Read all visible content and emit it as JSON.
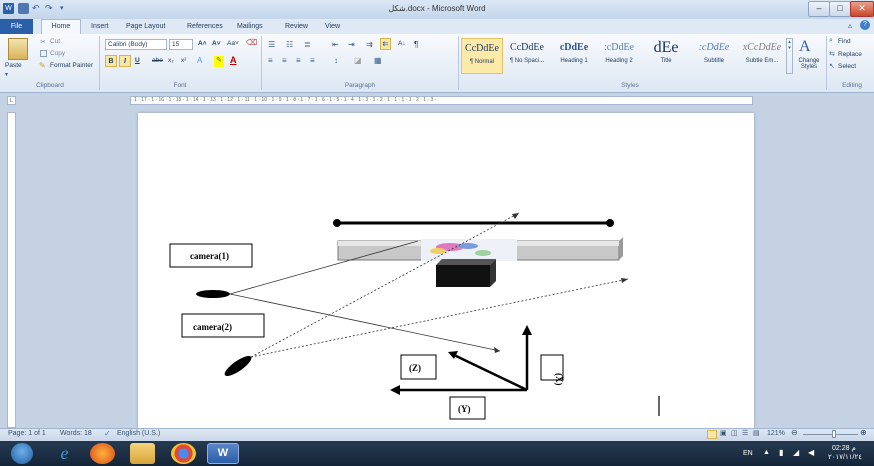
{
  "window": {
    "title": "شكل.docx - Microsoft Word",
    "controls": [
      "–",
      "□",
      "✕"
    ]
  },
  "tabs": [
    {
      "label": "File"
    },
    {
      "label": "Home"
    },
    {
      "label": "Insert"
    },
    {
      "label": "Page Layout"
    },
    {
      "label": "References"
    },
    {
      "label": "Mailings"
    },
    {
      "label": "Review"
    },
    {
      "label": "View"
    }
  ],
  "clipboard": {
    "paste": "Paste",
    "cut": "Cut",
    "copy": "Copy",
    "format_painter": "Format Painter",
    "label": "Clipboard"
  },
  "font": {
    "name": "Calibri (Body)",
    "size": "15",
    "bold": "B",
    "italic": "I",
    "underline": "U",
    "strike": "abe",
    "sub": "x₂",
    "sup": "x²",
    "label": "Font",
    "grow": "A˄",
    "shrink": "A˅",
    "case": "Aa˅"
  },
  "paragraph": {
    "label": "Paragraph",
    "sort": "A↓",
    "pilcrow": "¶"
  },
  "styles": {
    "label": "Styles",
    "items": [
      {
        "sample": "CcDdEe",
        "name": "¶ Normal"
      },
      {
        "sample": "CcDdEe",
        "name": "¶ No Spaci..."
      },
      {
        "sample": "cDdEe",
        "name": "Heading 1"
      },
      {
        "sample": ":cDdEe",
        "name": "Heading 2"
      },
      {
        "sample": "dEe",
        "name": "Title"
      },
      {
        "sample": ":cDdEe",
        "name": "Subtitle"
      },
      {
        "sample": "xCcDdEe",
        "name": "Subtle Em..."
      }
    ],
    "change": "Change Styles"
  },
  "editing": {
    "label": "Editing",
    "find": "Find",
    "replace": "Replace",
    "select": "Select"
  },
  "ruler": {
    "marks": "· 1 · 17 · 1 · 16 · 1 · 15 · 1 · 14 · 1 · 13 · 1 · 12 · 1 · 11 · 1 · 10 · 1 · 9 · 1 · 8 · 1 · 7 · 1 · 6 · 1 · 5 · 1 · 4 · 1 · 3 · 1 · 2 · 1 · 1 · 1 · 1 · 2 · 1 · 3 ·"
  },
  "diagram": {
    "camera1": "camera(1)",
    "camera2": "camera(2)",
    "axis_z": "(Z)",
    "axis_y": "(Y)",
    "axis_x": "(X)"
  },
  "status": {
    "page": "Page: 1 of 1",
    "words": "Words: 18",
    "language": "English (U.S.)",
    "zoom": "121%"
  },
  "taskbar": {
    "lang": "EN",
    "time": "02:28 م",
    "date": "٢٠١٧/١١/٢٤"
  },
  "colors": {
    "accent": "#2b5fa8",
    "ribbon": "#dde7f3",
    "taskbar": "#1b2d42"
  }
}
